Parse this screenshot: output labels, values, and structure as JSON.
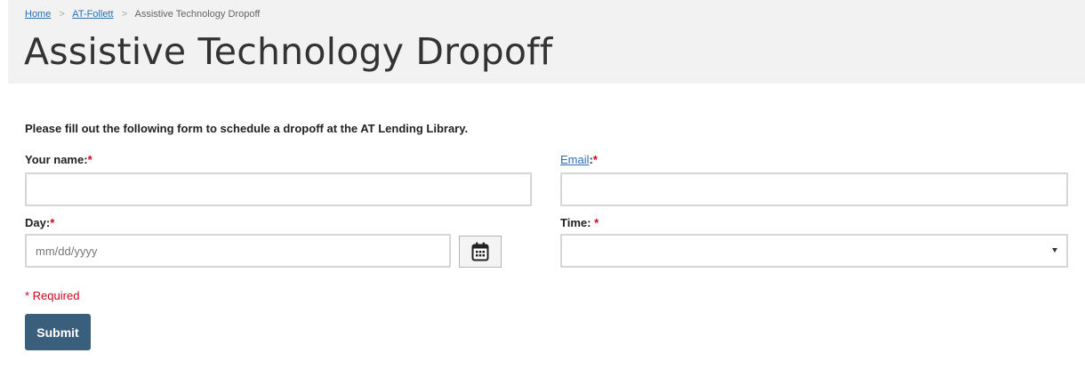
{
  "breadcrumb": {
    "items": [
      "Home",
      "AT-Follett",
      "Assistive Technology Dropoff"
    ],
    "separator": ">"
  },
  "page": {
    "title": "Assistive Technology Dropoff",
    "intro": "Please fill out the following form to schedule a dropoff at the AT Lending Library."
  },
  "form": {
    "name_label": "Your name:",
    "name_value": "",
    "email_label_link": "Email",
    "email_label_suffix": ":",
    "email_value": "",
    "day_label": "Day:",
    "day_placeholder": "mm/dd/yyyy",
    "day_value": "",
    "time_label": "Time: ",
    "time_selected": "",
    "required_mark": "*",
    "required_note": "* Required",
    "submit_label": "Submit"
  },
  "icons": {
    "calendar": "calendar-icon",
    "dropdown": "chevron-down-icon"
  },
  "colors": {
    "link": "#2a6fb8",
    "required": "#d0021b",
    "submit_bg": "#3a5f7d",
    "header_bg": "#f2f2f2"
  }
}
